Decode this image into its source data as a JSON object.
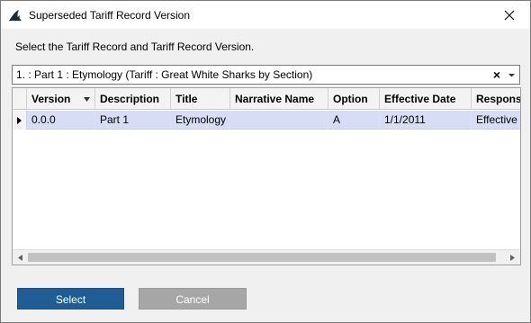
{
  "window": {
    "title": "Superseded Tariff Record Version",
    "app_icon": "shark-fin-icon",
    "close_icon": "close-icon"
  },
  "instruction": "Select the Tariff Record and Tariff Record Version.",
  "record_combo": {
    "value": "1. : Part 1 : Etymology (Tariff : Great White Sharks by Section)",
    "clear_icon": "clear-icon",
    "dropdown_icon": "chevron-down-icon"
  },
  "grid": {
    "columns": [
      "Version",
      "Description",
      "Title",
      "Narrative Name",
      "Option",
      "Effective Date",
      "Respons"
    ],
    "sort_icon": "sort-desc-icon",
    "rows": [
      {
        "version": "0.0.0",
        "description": "Part 1",
        "title": "Etymology",
        "narrative_name": "",
        "option": "A",
        "effective_date": "1/1/2011",
        "response": "Effective"
      }
    ]
  },
  "buttons": {
    "select": "Select",
    "cancel": "Cancel"
  },
  "colors": {
    "primary_button": "#1f5e94",
    "disabled_button": "#a6a6a6",
    "selected_row": "#d6ddf4"
  }
}
